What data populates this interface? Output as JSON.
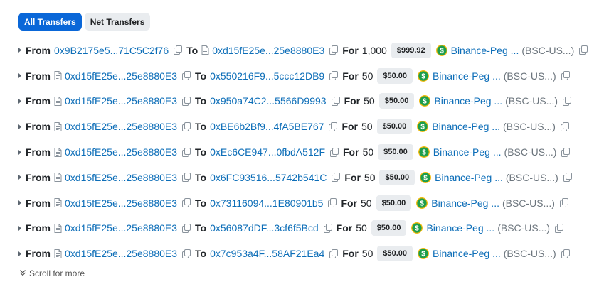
{
  "tabs": [
    {
      "label": "All Transfers",
      "active": true
    },
    {
      "label": "Net Transfers",
      "active": false
    }
  ],
  "labels": {
    "from": "From",
    "to": "To",
    "for": "For"
  },
  "transfers": [
    {
      "from": "0x9B2175e5...71C5C2f76",
      "from_contract": false,
      "to": "0xd15fE25e...25e8880E3",
      "to_contract": true,
      "amount": "1,000",
      "value": "$999.92",
      "token": "Binance-Peg ...",
      "symbol": "(BSC-US...)"
    },
    {
      "from": "0xd15fE25e...25e8880E3",
      "from_contract": true,
      "to": "0x550216F9...5ccc12DB9",
      "to_contract": false,
      "amount": "50",
      "value": "$50.00",
      "token": "Binance-Peg ...",
      "symbol": "(BSC-US...)"
    },
    {
      "from": "0xd15fE25e...25e8880E3",
      "from_contract": true,
      "to": "0x950a74C2...5566D9993",
      "to_contract": false,
      "amount": "50",
      "value": "$50.00",
      "token": "Binance-Peg ...",
      "symbol": "(BSC-US...)"
    },
    {
      "from": "0xd15fE25e...25e8880E3",
      "from_contract": true,
      "to": "0xBE6b2Bf9...4fA5BE767",
      "to_contract": false,
      "amount": "50",
      "value": "$50.00",
      "token": "Binance-Peg ...",
      "symbol": "(BSC-US...)"
    },
    {
      "from": "0xd15fE25e...25e8880E3",
      "from_contract": true,
      "to": "0xEc6CE947...0fbdA512F",
      "to_contract": false,
      "amount": "50",
      "value": "$50.00",
      "token": "Binance-Peg ...",
      "symbol": "(BSC-US...)"
    },
    {
      "from": "0xd15fE25e...25e8880E3",
      "from_contract": true,
      "to": "0x6FC93516...5742b541C",
      "to_contract": false,
      "amount": "50",
      "value": "$50.00",
      "token": "Binance-Peg ...",
      "symbol": "(BSC-US...)"
    },
    {
      "from": "0xd15fE25e...25e8880E3",
      "from_contract": true,
      "to": "0x73116094...1E80901b5",
      "to_contract": false,
      "amount": "50",
      "value": "$50.00",
      "token": "Binance-Peg ...",
      "symbol": "(BSC-US...)"
    },
    {
      "from": "0xd15fE25e...25e8880E3",
      "from_contract": true,
      "to": "0x56087dDF...3cf6f5Bcd",
      "to_contract": false,
      "amount": "50",
      "value": "$50.00",
      "token": "Binance-Peg ...",
      "symbol": "(BSC-US...)"
    },
    {
      "from": "0xd15fE25e...25e8880E3",
      "from_contract": true,
      "to": "0x7c953a4F...58AF21Ea4",
      "to_contract": false,
      "amount": "50",
      "value": "$50.00",
      "token": "Binance-Peg ...",
      "symbol": "(BSC-US...)"
    }
  ],
  "scroll_more": "Scroll for more",
  "icons": {
    "caret": "caret-right-icon",
    "contract": "document-icon",
    "copy": "copy-icon",
    "token": "dollar-coin-icon",
    "scroll": "double-chevron-down-icon"
  },
  "colors": {
    "accent": "#0a67d8",
    "link": "#0d6eb8",
    "coin_green": "#1d9e4c",
    "coin_ring": "#f0b90b"
  }
}
